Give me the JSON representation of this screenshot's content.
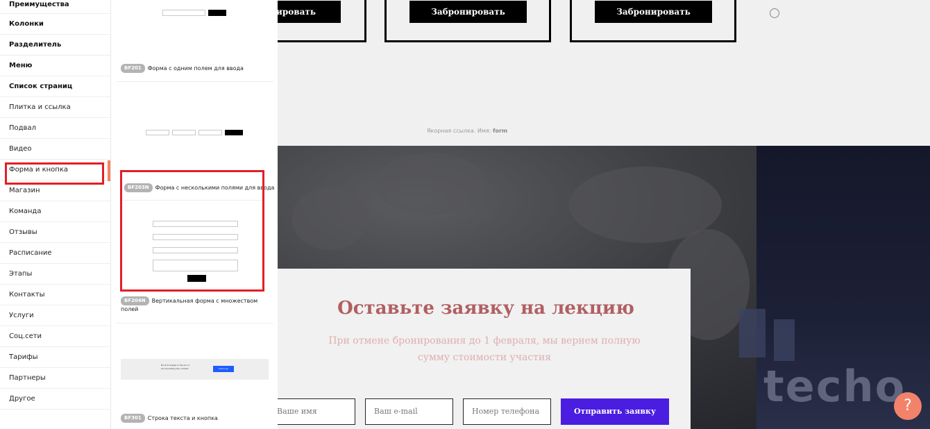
{
  "categories": [
    {
      "label": "Преимущества",
      "bold": true
    },
    {
      "label": "Колонки",
      "bold": true
    },
    {
      "label": "Разделитель",
      "bold": true
    },
    {
      "label": "Меню",
      "bold": true
    },
    {
      "label": "Список страниц",
      "bold": true
    },
    {
      "label": "Плитка и ссылка",
      "bold": false
    },
    {
      "label": "Подвал",
      "bold": false
    },
    {
      "label": "Видео",
      "bold": false
    },
    {
      "label": "Форма и кнопка",
      "bold": false,
      "active": true
    },
    {
      "label": "Магазин",
      "bold": false
    },
    {
      "label": "Команда",
      "bold": false
    },
    {
      "label": "Отзывы",
      "bold": false
    },
    {
      "label": "Расписание",
      "bold": false
    },
    {
      "label": "Этапы",
      "bold": false
    },
    {
      "label": "Контакты",
      "bold": false
    },
    {
      "label": "Услуги",
      "bold": false
    },
    {
      "label": "Соц.сети",
      "bold": false
    },
    {
      "label": "Тарифы",
      "bold": false
    },
    {
      "label": "Партнеры",
      "bold": false
    },
    {
      "label": "Другое",
      "bold": false
    }
  ],
  "blocks": {
    "bf201": {
      "code": "BF201",
      "title": "Форма с одним полем для ввода"
    },
    "bf203": {
      "code": "BF203N",
      "title": "Форма с несколькими полями для ввода"
    },
    "bf204": {
      "code": "BF204N",
      "title": "Вертикальная форма с множеством полей"
    },
    "bf301": {
      "code": "BF301",
      "title": "Строка текста и кнопка",
      "thumb_text": "Book & design is the art of incorporating the content.",
      "thumb_btn": "Call to go"
    }
  },
  "canvas": {
    "book_label_partial": "нировать",
    "book_label": "Забронировать",
    "anchor_prefix": "Якорная ссылка. Имя:",
    "anchor_name": "form",
    "form": {
      "title": "Оставьте заявку на лекцию",
      "subtitle": "При отмене бронирования до 1 февраля, мы вернем полную сумму стоимости участия",
      "name_placeholder": "Ваше имя",
      "email_placeholder": "Ваш  e-mail",
      "phone_placeholder": "Номер телефона",
      "submit_label": "Отправить заявку"
    },
    "photo_word": "techo"
  },
  "help_label": "?"
}
